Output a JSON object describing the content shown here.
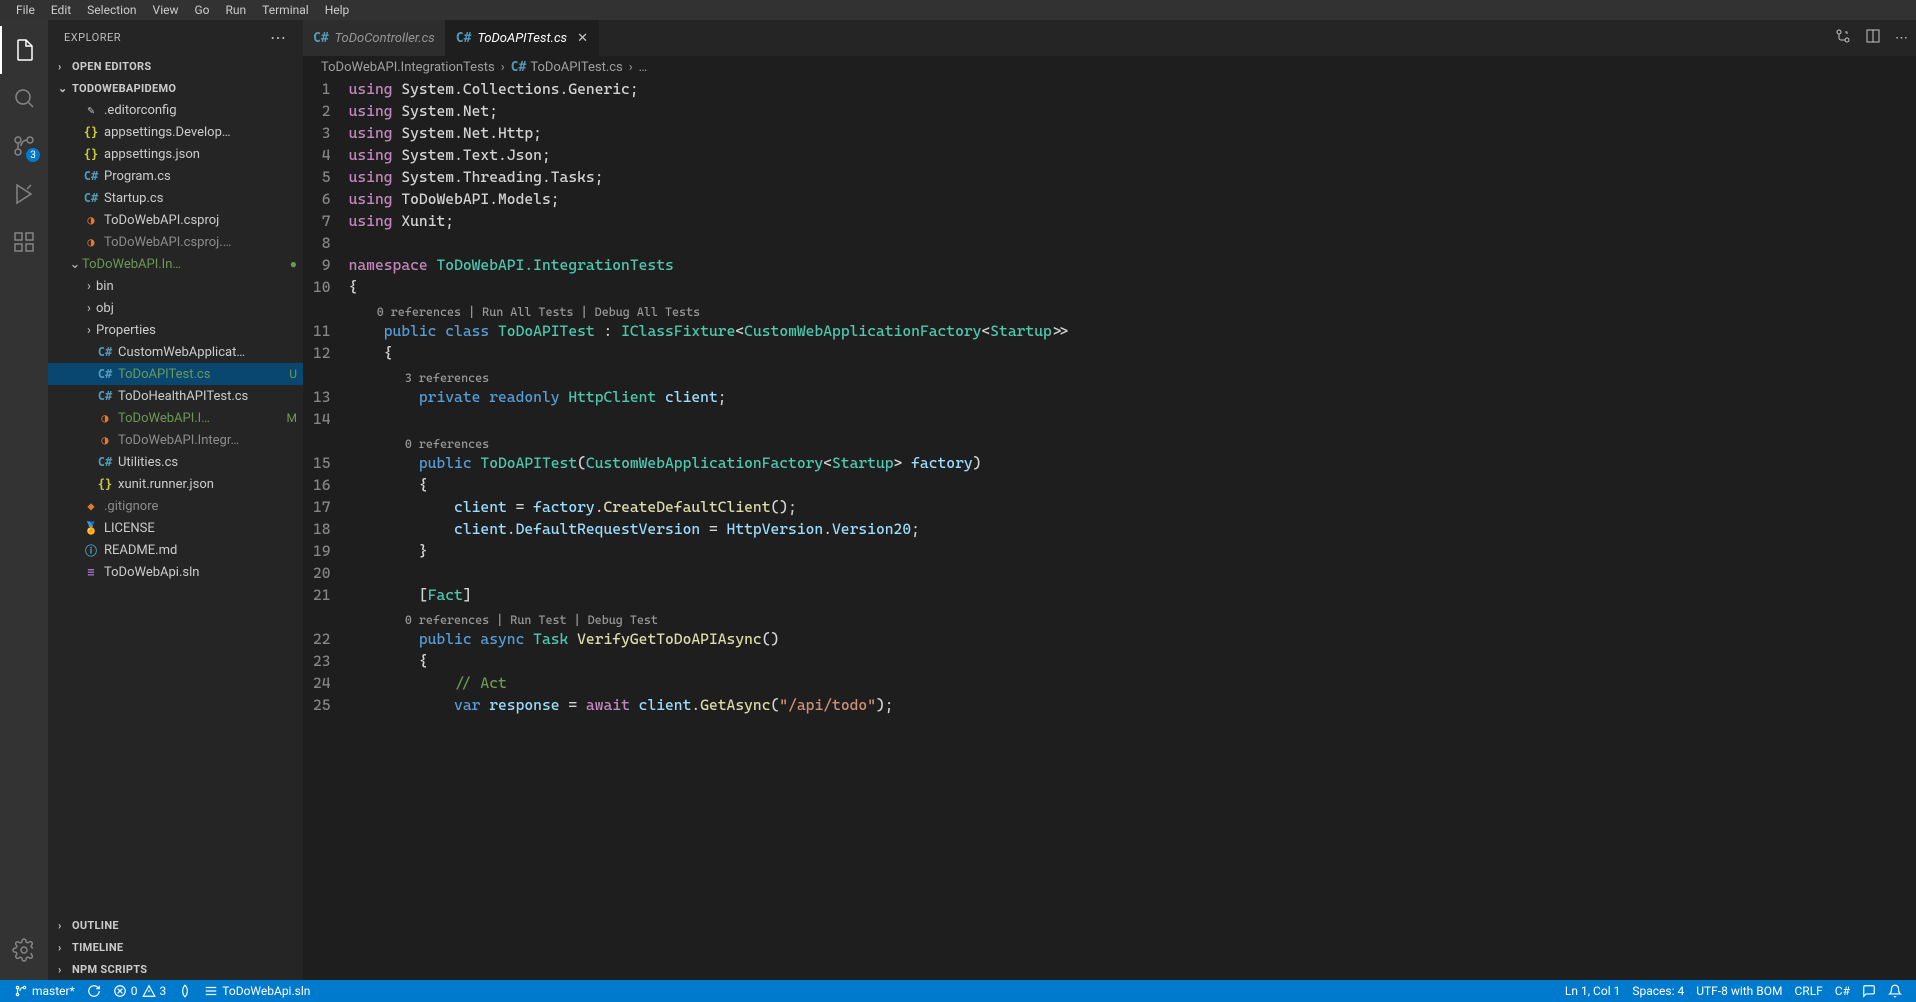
{
  "menubar": [
    "File",
    "Edit",
    "Selection",
    "View",
    "Go",
    "Run",
    "Terminal",
    "Help"
  ],
  "sidebar": {
    "title": "EXPLORER",
    "open_editors": "OPEN EDITORS",
    "workspace": "TODOWEBAPIDEMO",
    "tree": [
      {
        "indent": 0,
        "chev": "",
        "icon": "cfg",
        "iconGlyph": "✎",
        "label": ".editorconfig"
      },
      {
        "indent": 0,
        "chev": "",
        "icon": "json",
        "iconGlyph": "{}",
        "label": "appsettings.Develop…"
      },
      {
        "indent": 0,
        "chev": "",
        "icon": "json",
        "iconGlyph": "{}",
        "label": "appsettings.json"
      },
      {
        "indent": 0,
        "chev": "",
        "icon": "cs",
        "iconGlyph": "C#",
        "label": "Program.cs"
      },
      {
        "indent": 0,
        "chev": "",
        "icon": "cs",
        "iconGlyph": "C#",
        "label": "Startup.cs"
      },
      {
        "indent": 0,
        "chev": "",
        "icon": "feed",
        "iconGlyph": "◑",
        "label": "ToDoWebAPI.csproj"
      },
      {
        "indent": 0,
        "chev": "",
        "icon": "feed",
        "iconGlyph": "◑",
        "label": "ToDoWebAPI.csproj.…",
        "dim": true
      },
      {
        "indent": 0,
        "chev": "⌄",
        "icon": "",
        "iconGlyph": "",
        "label": "ToDoWebAPI.In…",
        "decoration": "●",
        "decorClass": "green",
        "folder": true,
        "labelClass": "green"
      },
      {
        "indent": 1,
        "chev": "›",
        "icon": "",
        "iconGlyph": "",
        "label": "bin",
        "folder": true,
        "dimchev": true
      },
      {
        "indent": 1,
        "chev": "›",
        "icon": "",
        "iconGlyph": "",
        "label": "obj",
        "folder": true,
        "dimchev": true
      },
      {
        "indent": 1,
        "chev": "›",
        "icon": "",
        "iconGlyph": "",
        "label": "Properties",
        "folder": true
      },
      {
        "indent": 1,
        "chev": "",
        "icon": "cs",
        "iconGlyph": "C#",
        "label": "CustomWebApplicat…"
      },
      {
        "indent": 1,
        "chev": "",
        "icon": "cs",
        "iconGlyph": "C#",
        "label": "ToDoAPITest.cs",
        "selected": true,
        "decoration": "U",
        "decorClass": "green",
        "labelClass": "green"
      },
      {
        "indent": 1,
        "chev": "",
        "icon": "cs",
        "iconGlyph": "C#",
        "label": "ToDoHealthAPITest.cs"
      },
      {
        "indent": 1,
        "chev": "",
        "icon": "feed",
        "iconGlyph": "◑",
        "label": "ToDoWebAPI.I…",
        "decoration": "M",
        "decorClass": "green",
        "labelClass": "green"
      },
      {
        "indent": 1,
        "chev": "",
        "icon": "feed",
        "iconGlyph": "◑",
        "label": "ToDoWebAPI.Integr…",
        "dim": true
      },
      {
        "indent": 1,
        "chev": "",
        "icon": "cs",
        "iconGlyph": "C#",
        "label": "Utilities.cs"
      },
      {
        "indent": 1,
        "chev": "",
        "icon": "json",
        "iconGlyph": "{}",
        "label": "xunit.runner.json"
      },
      {
        "indent": 0,
        "chev": "",
        "icon": "git",
        "iconGlyph": "◆",
        "label": ".gitignore",
        "dim": true
      },
      {
        "indent": 0,
        "chev": "",
        "icon": "lic",
        "iconGlyph": "🏅",
        "label": "LICENSE"
      },
      {
        "indent": 0,
        "chev": "",
        "icon": "md",
        "iconGlyph": "ⓘ",
        "label": "README.md"
      },
      {
        "indent": 0,
        "chev": "",
        "icon": "sln",
        "iconGlyph": "≡",
        "label": "ToDoWebApi.sln"
      }
    ],
    "outline": "OUTLINE",
    "timeline": "TIMELINE",
    "npm": "NPM SCRIPTS",
    "scm_badge": "3"
  },
  "tabs": [
    {
      "icon": "C#",
      "label": "ToDoController.cs",
      "active": false
    },
    {
      "icon": "C#",
      "label": "ToDoAPITest.cs",
      "active": true,
      "close": true
    }
  ],
  "breadcrumb": {
    "parts": [
      "ToDoWebAPI.IntegrationTests",
      "ToDoAPITest.cs",
      "…"
    ],
    "icon_index": 1
  },
  "gutter_lines": [
    "1",
    "2",
    "3",
    "4",
    "5",
    "6",
    "7",
    "8",
    "9",
    "10",
    "",
    "11",
    "12",
    "",
    "13",
    "14",
    "",
    "15",
    "16",
    "17",
    "18",
    "19",
    "20",
    "21",
    "",
    "22",
    "23",
    "24",
    "25"
  ],
  "codelens": {
    "class": "0 references | Run All Tests | Debug All Tests",
    "field": "3 references",
    "ctor": "0 references",
    "method": "0 references | Run Test | Debug Test"
  },
  "code": {
    "u": "using",
    "ns_kw": "namespace",
    "ns": "ToDoWebAPI.IntegrationTests",
    "usings": [
      "System.Collections.Generic",
      "System.Net",
      "System.Net.Http",
      "System.Text.Json",
      "System.Threading.Tasks",
      "ToDoWebAPI.Models",
      "Xunit"
    ],
    "class_sig": {
      "public": "public",
      "class": "class",
      "name": "ToDoAPITest",
      "colon": ":",
      "iface": "IClassFixture",
      "open": "<",
      "factType": "CustomWebApplicationFactory",
      "open2": "<",
      "startup": "Startup",
      "close": ">>"
    },
    "field": {
      "private": "private",
      "readonly": "readonly",
      "type": "HttpClient",
      "name": "client"
    },
    "ctor": {
      "public": "public",
      "name": "ToDoAPITest",
      "open": "(",
      "ptype": "CustomWebApplicationFactory",
      "open2": "<",
      "startup": "Startup",
      "close2": ">",
      "pname": " factory",
      "close": ")"
    },
    "body1": {
      "lhs": "client",
      "eq": " = ",
      "rhs_var": "factory",
      "dot": ".",
      "call": "CreateDefaultClient",
      "paren": "();"
    },
    "body2": {
      "lhs": "client",
      "dot": ".",
      "prop": "DefaultRequestVersion",
      "eq": " = ",
      "type": "HttpVersion",
      "dot2": ".",
      "val": "Version20",
      "semi": ";"
    },
    "attr": {
      "open": "[",
      "name": "Fact",
      "close": "]"
    },
    "test": {
      "public": "public",
      "async": "async",
      "task": "Task",
      "name": "VerifyGetToDoAPIAsync",
      "paren": "()"
    },
    "comment": "// Act",
    "lastline": {
      "var": "var",
      "name": " response",
      "eq": " = ",
      "await": "await",
      "client": " client",
      "dot": ".",
      "method": "GetAsync",
      "open": "(",
      "str": "\"/api/todo\"",
      "close": ");"
    }
  },
  "status": {
    "branch": "master*",
    "errors": "0",
    "warnings": "3",
    "file": "ToDoWebApi.sln",
    "pos": "Ln 1, Col 1",
    "spaces": "Spaces: 4",
    "encoding": "UTF-8 with BOM",
    "eol": "CRLF",
    "lang": "C#"
  }
}
